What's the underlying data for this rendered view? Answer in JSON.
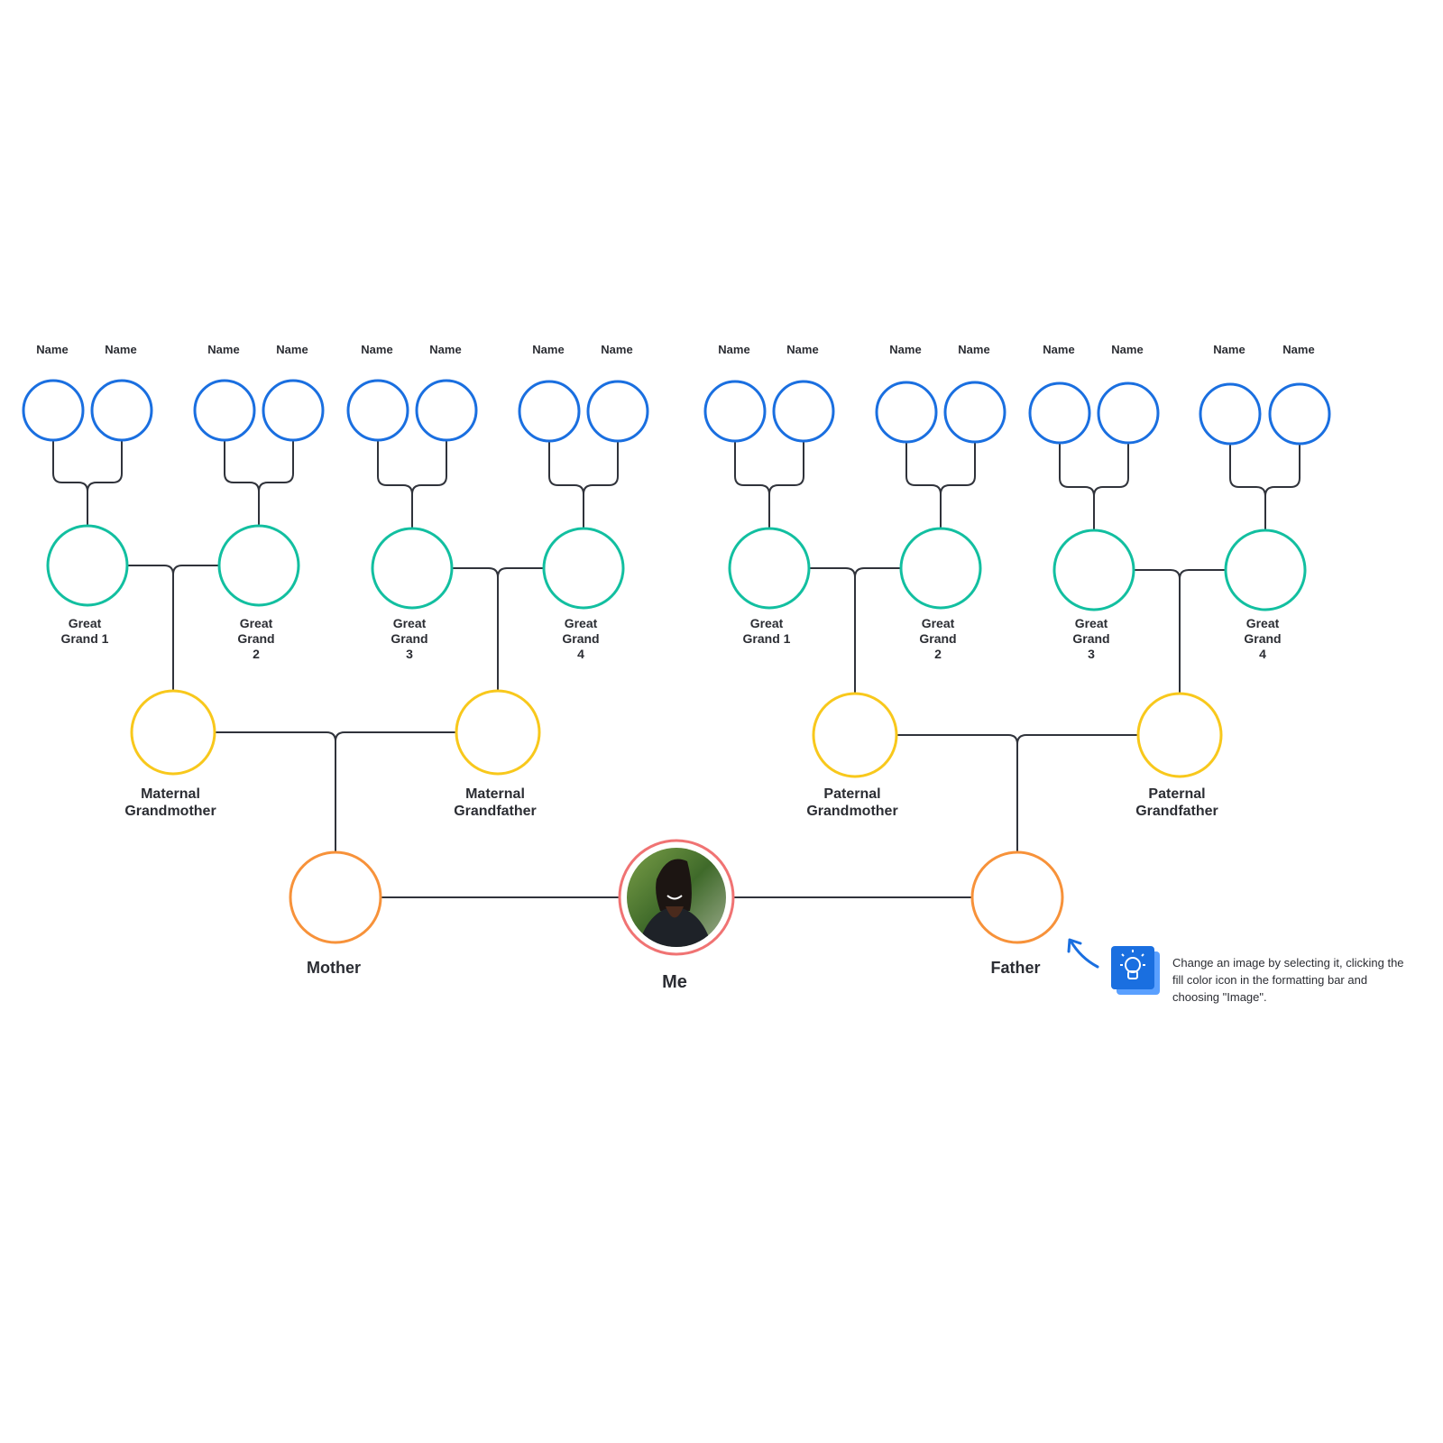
{
  "colors": {
    "great_great_grand": "#1a6fe0",
    "great_grand": "#12bfa0",
    "grandparent": "#f8c81c",
    "parent": "#f7923a",
    "me": "#f07373",
    "connector": "#30333b",
    "tip_icon": "#1a6fe0"
  },
  "great_great_grandparents": [
    "Name",
    "Name",
    "Name",
    "Name",
    "Name",
    "Name",
    "Name",
    "Name",
    "Name",
    "Name",
    "Name",
    "Name",
    "Name",
    "Name",
    "Name",
    "Name"
  ],
  "great_grandparents": [
    [
      "Great",
      "Grand 1"
    ],
    [
      "Great",
      "Grand",
      "2"
    ],
    [
      "Great",
      "Grand",
      "3"
    ],
    [
      "Great",
      "Grand",
      "4"
    ],
    [
      "Great",
      "Grand 1"
    ],
    [
      "Great",
      "Grand",
      "2"
    ],
    [
      "Great",
      "Grand",
      "3"
    ],
    [
      "Great",
      "Grand",
      "4"
    ]
  ],
  "grandparents": [
    [
      "Maternal",
      "Grandmother"
    ],
    [
      "Maternal",
      "Grandfather"
    ],
    [
      "Paternal",
      "Grandmother"
    ],
    [
      "Paternal",
      "Grandfather"
    ]
  ],
  "parents": [
    "Mother",
    "Father"
  ],
  "me": {
    "label": "Me",
    "image": "portrait photo"
  },
  "tip": {
    "icon": "lightbulb-icon",
    "text": "Change an image by selecting it, clicking the fill color icon in the formatting bar and choosing \"Image\"."
  }
}
